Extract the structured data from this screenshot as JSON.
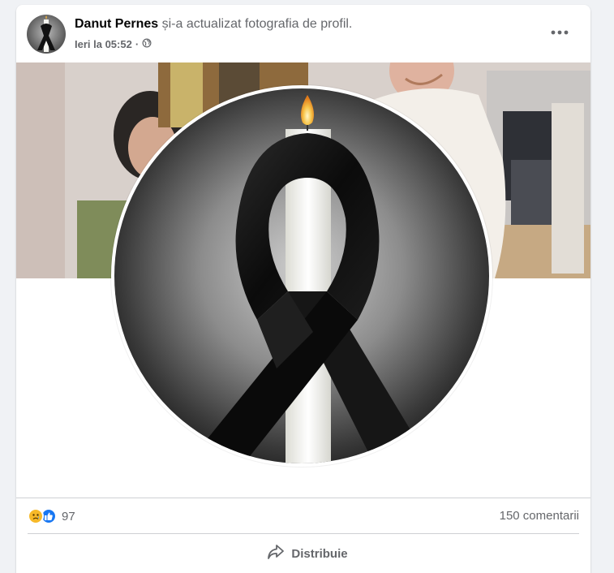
{
  "post": {
    "author_name": "Danut Pernes",
    "action_text": " și-a actualizat fotografia de profil.",
    "timestamp": "Ieri la 05:52",
    "separator": "·",
    "privacy_icon": "globe-icon",
    "more_icon": "more-horizontal-icon"
  },
  "stats": {
    "reaction_icons": [
      "sad-reaction-icon",
      "like-reaction-icon"
    ],
    "reaction_count": "97",
    "comments_label": "150 comentarii"
  },
  "actions": {
    "share_label": "Distribuie",
    "share_icon": "share-arrow-icon"
  },
  "colors": {
    "name_text": "#050505",
    "secondary_text": "#65676b",
    "like_blue": "#1877f2",
    "sad_yellow": "#f7b928",
    "divider": "#ced0d4",
    "background": "#f0f2f5"
  }
}
